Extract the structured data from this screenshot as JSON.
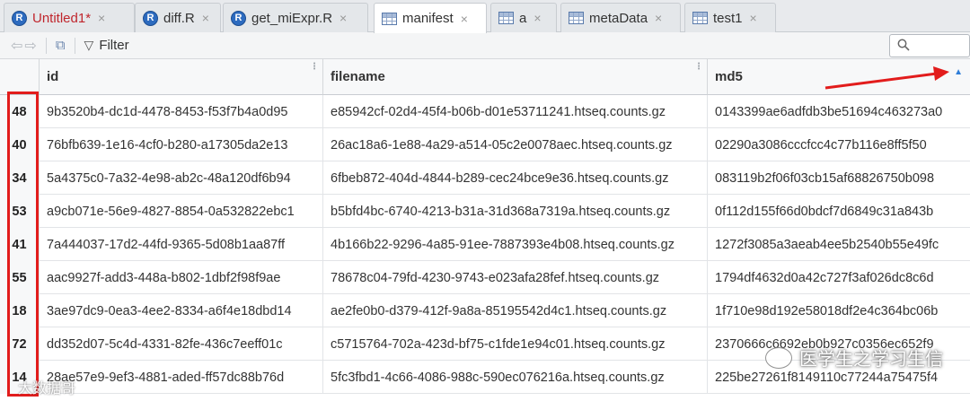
{
  "tabs": [
    {
      "label": "Untitled1*",
      "icon": "r-script-icon",
      "unsaved": true
    },
    {
      "label": "diff.R",
      "icon": "r-script-icon"
    },
    {
      "label": "get_miExpr.R",
      "icon": "r-script-icon"
    },
    {
      "label": "manifest",
      "icon": "table-icon",
      "active": true
    },
    {
      "label": "a",
      "icon": "table-icon"
    },
    {
      "label": "metaData",
      "icon": "table-icon"
    },
    {
      "label": "test1",
      "icon": "table-icon"
    }
  ],
  "tab_close_glyph": "×",
  "toolbar": {
    "filter_label": "Filter",
    "search_placeholder": ""
  },
  "columns": [
    "id",
    "filename",
    "md5"
  ],
  "sort": {
    "column": "md5",
    "direction": "ascending"
  },
  "rows": [
    {
      "rn": "48",
      "id": "9b3520b4-dc1d-4478-8453-f53f7b4a0d95",
      "filename": "e85942cf-02d4-45f4-b06b-d01e53711241.htseq.counts.gz",
      "md5": "0143399ae6adfdb3be51694c463273a0"
    },
    {
      "rn": "40",
      "id": "76bfb639-1e16-4cf0-b280-a17305da2e13",
      "filename": "26ac18a6-1e88-4a29-a514-05c2e0078aec.htseq.counts.gz",
      "md5": "02290a3086cccfcc4c77b116e8ff5f50"
    },
    {
      "rn": "34",
      "id": "5a4375c0-7a32-4e98-ab2c-48a120df6b94",
      "filename": "6fbeb872-404d-4844-b289-cec24bce9e36.htseq.counts.gz",
      "md5": "083119b2f06f03cb15af68826750b098"
    },
    {
      "rn": "53",
      "id": "a9cb071e-56e9-4827-8854-0a532822ebc1",
      "filename": "b5bfd4bc-6740-4213-b31a-31d368a7319a.htseq.counts.gz",
      "md5": "0f112d155f66d0bdcf7d6849c31a843b"
    },
    {
      "rn": "41",
      "id": "7a444037-17d2-44fd-9365-5d08b1aa87ff",
      "filename": "4b166b22-9296-4a85-91ee-7887393e4b08.htseq.counts.gz",
      "md5": "1272f3085a3aeab4ee5b2540b55e49fc"
    },
    {
      "rn": "55",
      "id": "aac9927f-add3-448a-b802-1dbf2f98f9ae",
      "filename": "78678c04-79fd-4230-9743-e023afa28fef.htseq.counts.gz",
      "md5": "1794df4632d0a42c727f3af026dc8c6d"
    },
    {
      "rn": "18",
      "id": "3ae97dc9-0ea3-4ee2-8334-a6f4e18dbd14",
      "filename": "ae2fe0b0-d379-412f-9a8a-85195542d4c1.htseq.counts.gz",
      "md5": "1f710e98d192e58018df2e4c364bc06b"
    },
    {
      "rn": "72",
      "id": "dd352d07-5c4d-4331-82fe-436c7eeff01c",
      "filename": "c5715764-702a-423d-bf75-c1fde1e94c01.htseq.counts.gz",
      "md5": "2370666c6692eb0b927c0356ec652f9"
    },
    {
      "rn": "14",
      "id": "28ae57e9-9ef3-4881-aded-ff57dc88b76d",
      "filename": "5fc3fbd1-4c66-4086-988c-590ec076216a.htseq.counts.gz",
      "md5": "225be27261f8149110c77244a75475f4"
    }
  ],
  "watermark": {
    "right": "医学生之学习生信",
    "left": "大数据哥"
  },
  "colors": {
    "annotation": "#e21c1c",
    "sort_arrow": "#2f7ed8",
    "unsaved_tab": "#c0262d"
  }
}
